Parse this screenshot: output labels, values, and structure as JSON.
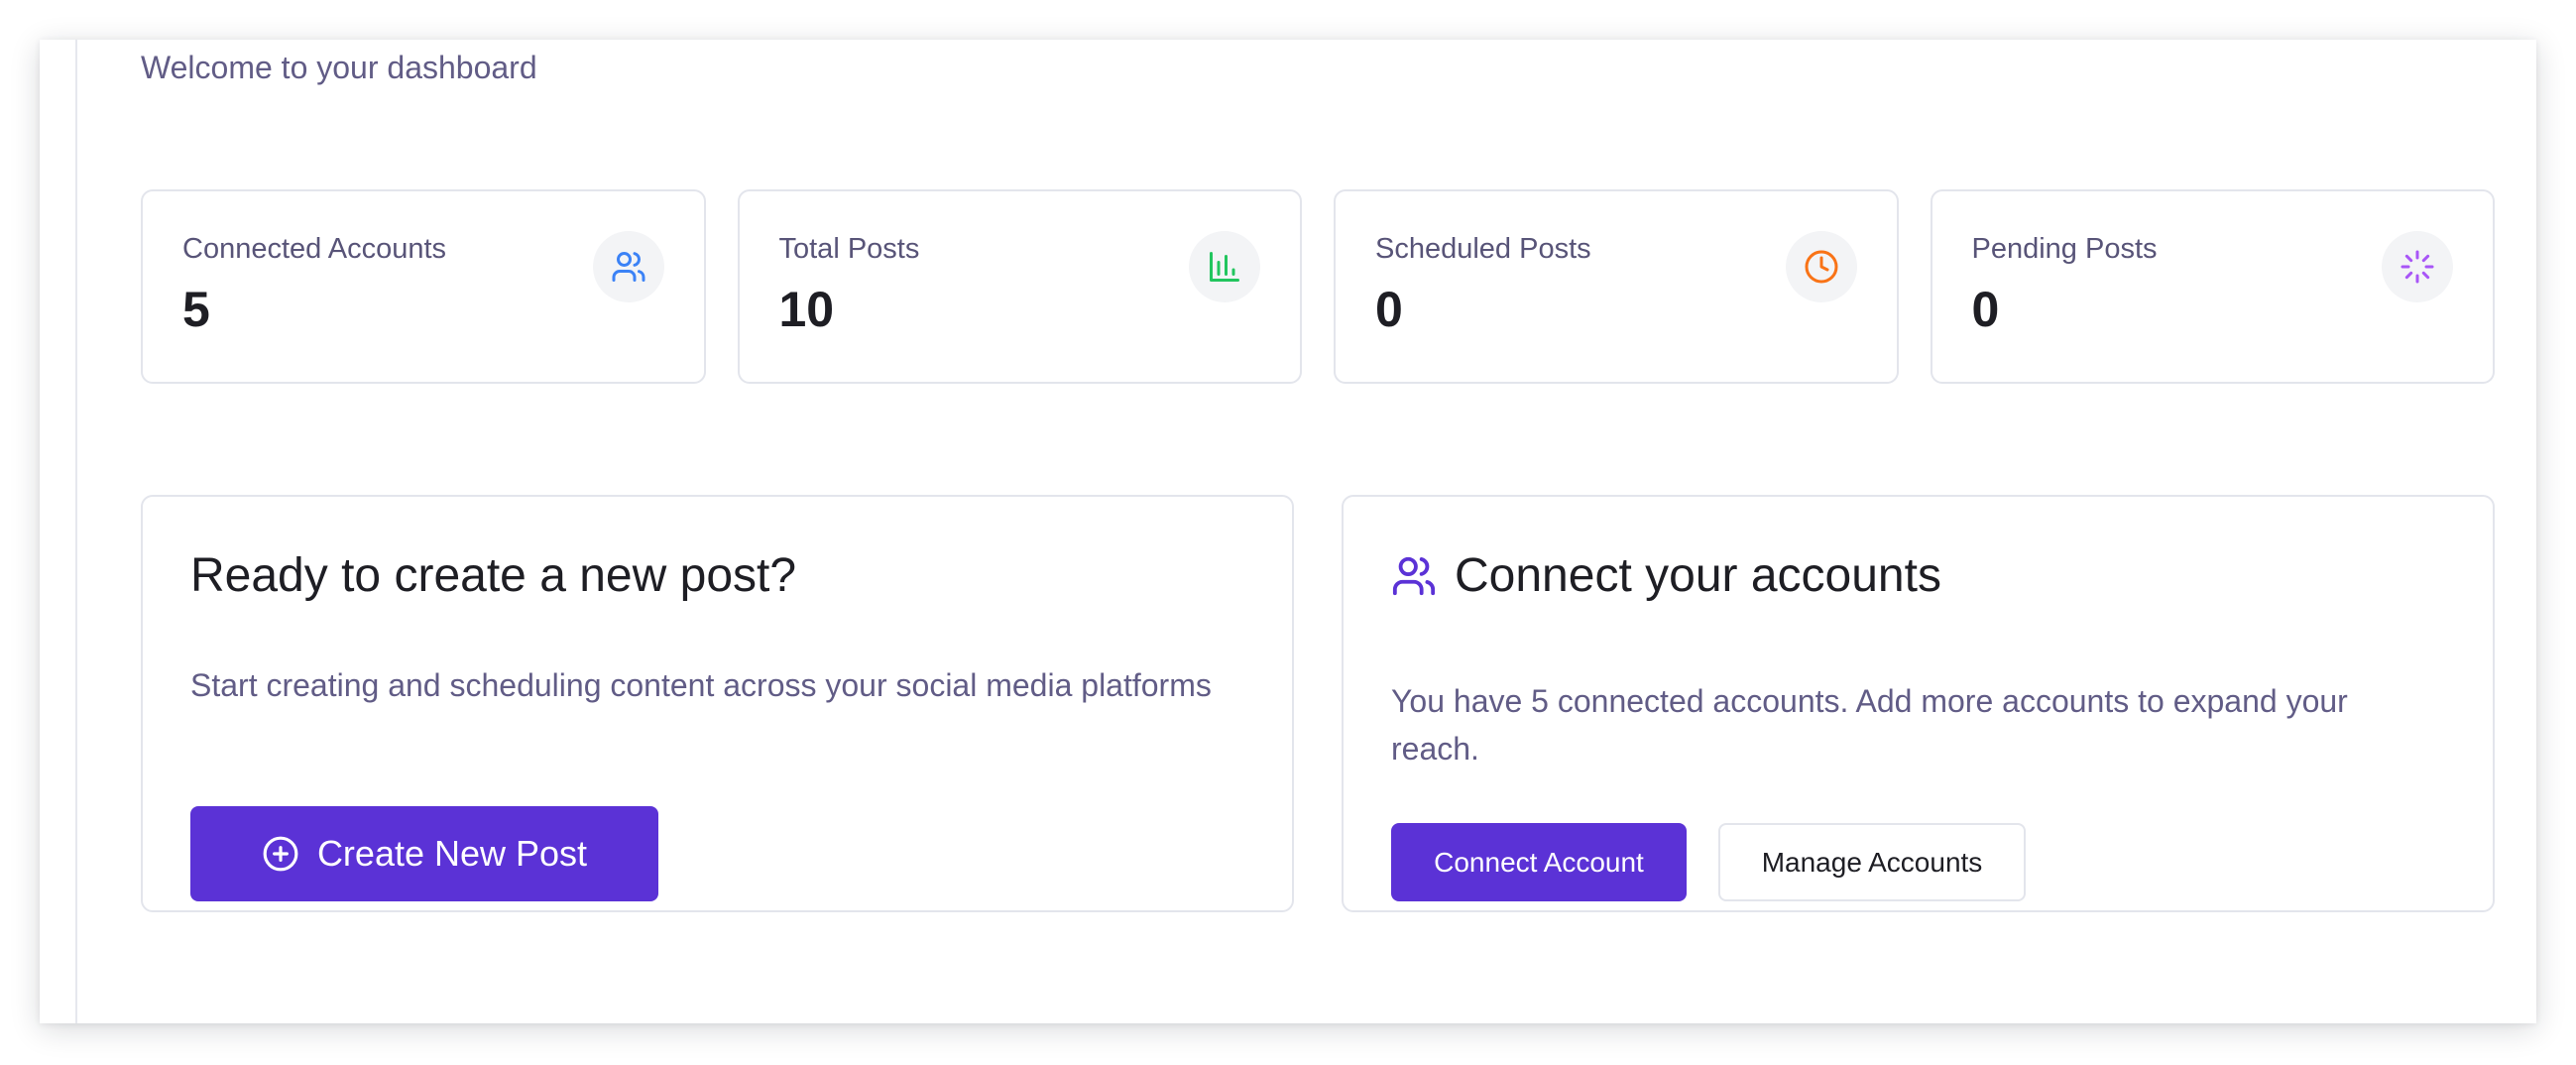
{
  "header": {
    "subtitle": "Welcome to your dashboard"
  },
  "stats": [
    {
      "label": "Connected Accounts",
      "value": "5",
      "icon": "users-icon",
      "color": "#3b82f6"
    },
    {
      "label": "Total Posts",
      "value": "10",
      "icon": "bar-chart-icon",
      "color": "#22c55e"
    },
    {
      "label": "Scheduled Posts",
      "value": "0",
      "icon": "clock-icon",
      "color": "#f97316"
    },
    {
      "label": "Pending Posts",
      "value": "0",
      "icon": "loader-icon",
      "color": "#a855f7"
    }
  ],
  "create_panel": {
    "title": "Ready to create a new post?",
    "description": "Start creating and scheduling content across your social media platforms",
    "button_label": "Create New Post",
    "button_icon": "plus-circle-icon"
  },
  "connect_panel": {
    "title": "Connect your accounts",
    "title_icon": "users-icon",
    "description": "You have 5 connected accounts. Add more accounts to expand your reach.",
    "primary_button": "Connect Account",
    "secondary_button": "Manage Accounts"
  },
  "theme": {
    "primary": "#5b32d6",
    "muted_text": "#615c86",
    "border": "#e3e5ec"
  }
}
